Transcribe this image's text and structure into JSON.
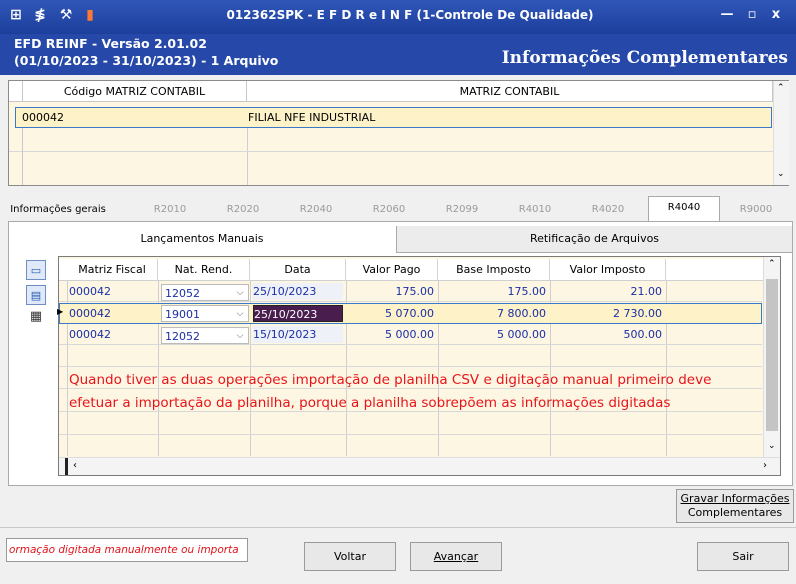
{
  "window": {
    "title": "012362SPK - E F D  R e I N F (1-Controle De Qualidade)",
    "minimize": "—",
    "maximize": "▫",
    "close": "x"
  },
  "header": {
    "version": "EFD REINF - Versão 2.01.02",
    "period": "(01/10/2023 - 31/10/2023) - 1 Arquivo",
    "section": "Informações Complementares"
  },
  "top_grid": {
    "col1": "Código MATRIZ CONTABIL",
    "col2": "MATRIZ CONTABIL",
    "row": {
      "code": "000042",
      "name": "FILIAL NFE INDUSTRIAL"
    }
  },
  "tabs": [
    {
      "label": "Informações gerais"
    },
    {
      "label": "R2010"
    },
    {
      "label": "R2020"
    },
    {
      "label": "R2040"
    },
    {
      "label": "R2060"
    },
    {
      "label": "R2099"
    },
    {
      "label": "R4010"
    },
    {
      "label": "R4020"
    },
    {
      "label": "R4040"
    },
    {
      "label": "R9000"
    }
  ],
  "subtabs": {
    "manual": "Lançamentos Manuais",
    "retificacao": "Retificação de Arquivos"
  },
  "grid": {
    "headers": [
      "Matriz Fiscal",
      "Nat. Rend.",
      "Data",
      "Valor Pago",
      "Base Imposto",
      "Valor Imposto"
    ],
    "rows": [
      {
        "matriz": "000042",
        "nat": "12052",
        "data": "25/10/2023",
        "pago": "175.00",
        "base": "175.00",
        "imposto": "21.00"
      },
      {
        "matriz": "000042",
        "nat": "19001",
        "data": "25/10/2023",
        "pago": "5 070.00",
        "base": "7 800.00",
        "imposto": "2 730.00"
      },
      {
        "matriz": "000042",
        "nat": "12052",
        "data": "15/10/2023",
        "pago": "5 000.00",
        "base": "5 000.00",
        "imposto": "500.00"
      }
    ],
    "message_line1": "Quando tiver as duas operações importação de planilha CSV e digitação manual primeiro deve",
    "message_line2": "efetuar a importação da planilha, porque a planilha sobrepõem as informações digitadas"
  },
  "buttons": {
    "gravar_line1": "Gravar Informações",
    "gravar_line2": "Complementares",
    "voltar": "Voltar",
    "avancar": "Avançar",
    "sair": "Sair"
  },
  "status": {
    "text": "ormação digitada manualmente ou importa"
  },
  "colors": {
    "title_bar": "#1d3f9c",
    "header": "#2648a8",
    "row_selected": "#fdf2c8",
    "message": "#e8141a",
    "value_text": "#1a2fa8"
  }
}
